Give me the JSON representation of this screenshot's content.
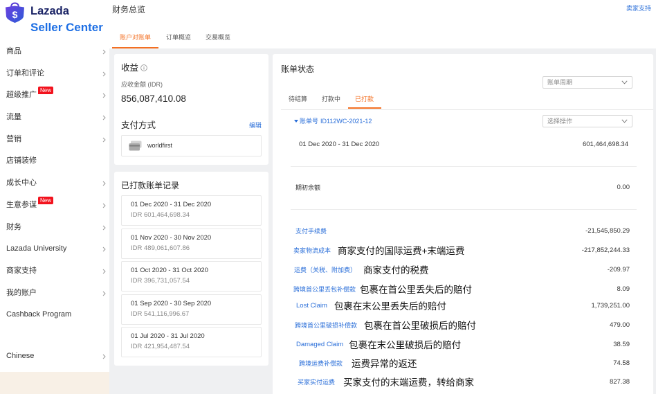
{
  "theme": {
    "accent": "#f36f22",
    "link": "#2b6fd9",
    "brand_blue": "#1e6fe4",
    "brand_navy": "#1b2466",
    "badge_red": "#f2121d",
    "sidebar_footer": "#f8f0e6",
    "page_background": "#eff0f2"
  },
  "brand": {
    "name": "Lazada",
    "subtitle": "Seller Center",
    "logo_glyph": "$"
  },
  "sidebar": {
    "items": [
      {
        "label": "商品"
      },
      {
        "label": "订单和评论"
      },
      {
        "label": "超级推广",
        "badge": "New"
      },
      {
        "label": "流量"
      },
      {
        "label": "营销"
      },
      {
        "label": "店铺装修"
      },
      {
        "label": "成长中心"
      },
      {
        "label": "生意参谋",
        "badge": "New"
      },
      {
        "label": "财务"
      },
      {
        "label": "Lazada University"
      },
      {
        "label": "商家支持"
      },
      {
        "label": "我的账户"
      },
      {
        "label": "Cashback Program"
      }
    ],
    "language": {
      "label": "Chinese"
    }
  },
  "header": {
    "title": "财务总览",
    "support_link": "卖家支持",
    "tabs": [
      {
        "label": "账户对账单",
        "active": true
      },
      {
        "label": "订单概览"
      },
      {
        "label": "交易概览"
      }
    ]
  },
  "earnings": {
    "title": "收益",
    "amount_label": "应收金额 (IDR)",
    "amount": "856,087,410.08"
  },
  "payment": {
    "title": "支付方式",
    "edit_label": "编辑",
    "method": "worldfirst"
  },
  "paid_history": {
    "title": "已打款账单记录",
    "records": [
      {
        "period": "01 Dec 2020 - 31 Dec 2020",
        "amount": "IDR 601,464,698.34"
      },
      {
        "period": "01 Nov 2020 - 30 Nov 2020",
        "amount": "IDR 489,061,607.86"
      },
      {
        "period": "01 Oct 2020 - 31 Oct 2020",
        "amount": "IDR 396,731,057.54"
      },
      {
        "period": "01 Sep 2020 - 30 Sep 2020",
        "amount": "IDR 541,116,996.67"
      },
      {
        "period": "01 Jul 2020 - 31 Jul 2020",
        "amount": "IDR 421,954,487.54"
      }
    ]
  },
  "statement": {
    "title": "账单状态",
    "period_select": {
      "placeholder": "账单周期"
    },
    "tabs": [
      {
        "label": "待结算"
      },
      {
        "label": "打款中"
      },
      {
        "label": "已打款",
        "active": true
      }
    ],
    "number_label": "账单号",
    "number": "ID112WC-2021-12",
    "action_select": {
      "placeholder": "选择操作"
    },
    "period": "01 Dec 2020 - 31 Dec 2020",
    "period_total": "601,464,698.34",
    "opening_balance": {
      "label": "期初余额",
      "value": "0.00"
    },
    "lines": [
      {
        "label": "支付手续费",
        "amount": "-21,545,850.29"
      },
      {
        "label": "卖家物流成本",
        "note": "商家支付的国际运费+末端运费",
        "amount": "-217,852,244.33"
      },
      {
        "label": "运费（关税、附加费）",
        "note": "商家支付的税费",
        "amount": "-209.97"
      },
      {
        "label": "跨境首公里丢包补偿款",
        "note": "包裹在首公里丢失后的赔付",
        "amount": "8.09"
      },
      {
        "label": "Lost Claim",
        "note": "包裹在末公里丢失后的赔付",
        "amount": "1,739,251.00"
      },
      {
        "label": "跨境首公里破损补偿款",
        "note": "包裹在首公里破损后的赔付",
        "amount": "479.00"
      },
      {
        "label": "Damaged Claim",
        "note": "包裹在末公里破损后的赔付",
        "amount": "38.59"
      },
      {
        "label": "跨境运费补偿款",
        "note": "运费异常的返还",
        "amount": "74.58"
      },
      {
        "label": "买家实付运费",
        "note": "买家支付的末端运费，转给商家",
        "amount": "827.38"
      }
    ]
  }
}
